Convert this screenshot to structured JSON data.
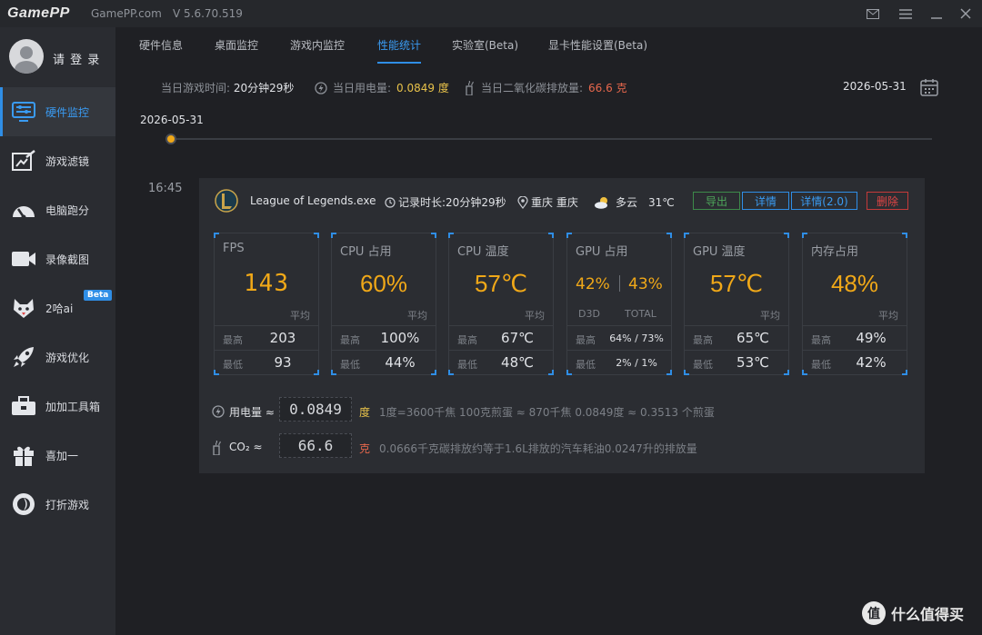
{
  "titlebar": {
    "logo": "GamePP",
    "site": "GamePP.com",
    "version": "V 5.6.70.519",
    "icons": [
      "mail-icon",
      "menu-icon",
      "minimize-icon",
      "close-icon"
    ]
  },
  "sidebar": {
    "login": "请 登 录",
    "items": [
      {
        "label": "硬件监控",
        "icon": "hardware-monitor-icon",
        "active": true
      },
      {
        "label": "游戏滤镜",
        "icon": "filter-icon"
      },
      {
        "label": "电脑跑分",
        "icon": "speedometer-icon"
      },
      {
        "label": "录像截图",
        "icon": "camera-icon"
      },
      {
        "label": "2哈ai",
        "icon": "husky-icon",
        "badge": "Beta"
      },
      {
        "label": "游戏优化",
        "icon": "rocket-icon"
      },
      {
        "label": "加加工具箱",
        "icon": "toolbox-icon"
      },
      {
        "label": "喜加一",
        "icon": "gift-icon"
      },
      {
        "label": "打折游戏",
        "icon": "discount-icon"
      }
    ]
  },
  "tabs": [
    {
      "label": "硬件信息"
    },
    {
      "label": "桌面监控"
    },
    {
      "label": "游戏内监控"
    },
    {
      "label": "性能统计",
      "active": true
    },
    {
      "label": "实验室(Beta)"
    },
    {
      "label": "显卡性能设置(Beta)"
    }
  ],
  "summary": {
    "play_time_label": "当日游戏时间:",
    "play_time_value": "20分钟29秒",
    "power_label": "当日用电量:",
    "power_value": "0.0849 度",
    "co2_label": "当日二氧化碳排放量:",
    "co2_value": "66.6 克",
    "date": "2026-05-31"
  },
  "timeline": {
    "date": "2026-05-31",
    "time": "16:45"
  },
  "session": {
    "game": "League of Legends.exe",
    "duration": "记录时长:20分钟29秒",
    "location": "重庆 重庆",
    "weather": "多云",
    "temperature": "31℃",
    "buttons": {
      "export": "导出",
      "detail": "详情",
      "detail2": "详情(2.0)",
      "delete": "删除"
    },
    "metrics": {
      "fps": {
        "title": "FPS",
        "avg": "143",
        "avg_label": "平均",
        "max_label": "最高",
        "max": "203",
        "min_label": "最低",
        "min": "93"
      },
      "cpu_usage": {
        "title": "CPU 占用",
        "avg": "60%",
        "avg_label": "平均",
        "max_label": "最高",
        "max": "100%",
        "min_label": "最低",
        "min": "44%"
      },
      "cpu_temp": {
        "title": "CPU 温度",
        "avg": "57℃",
        "avg_label": "平均",
        "max_label": "最高",
        "max": "67℃",
        "min_label": "最低",
        "min": "48℃"
      },
      "gpu_usage": {
        "title": "GPU 占用",
        "d3d": "42%",
        "total": "43%",
        "d3d_label": "D3D",
        "total_label": "TOTAL",
        "max_label": "最高",
        "max": "64% / 73%",
        "min_label": "最低",
        "min": "2% / 1%"
      },
      "gpu_temp": {
        "title": "GPU 温度",
        "avg": "57℃",
        "avg_label": "平均",
        "max_label": "最高",
        "max": "65℃",
        "min_label": "最低",
        "min": "53℃"
      },
      "mem_usage": {
        "title": "内存占用",
        "avg": "48%",
        "avg_label": "平均",
        "max_label": "最高",
        "max": "49%",
        "min_label": "最低",
        "min": "42%"
      }
    },
    "energy": {
      "power_label": "用电量 ≈",
      "power_value": "0.0849",
      "power_unit": "度",
      "power_desc": "1度=3600千焦    100克煎蛋 ≈ 870千焦    0.0849度 ≈ 0.3513 个煎蛋",
      "co2_label": "CO₂ ≈",
      "co2_value": "66.6",
      "co2_unit": "克",
      "co2_desc": "0.0666千克碳排放约等于1.6L排放的汽车耗油0.0247升的排放量"
    }
  },
  "watermark": "什么值得买",
  "colors": {
    "accent": "#2f8ee6",
    "value_orange": "#f0a818",
    "power_yellow": "#e8c24a",
    "co2_red": "#e7674c",
    "export_green": "#4ea85b",
    "delete_red": "#e04545"
  }
}
